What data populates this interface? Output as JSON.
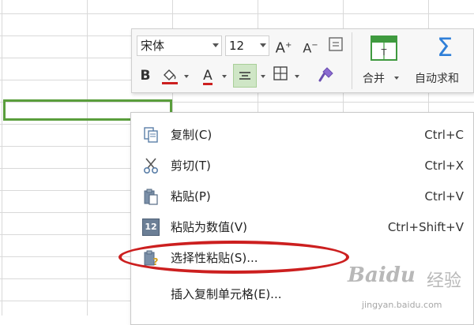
{
  "toolbar": {
    "font_name": "宋体",
    "font_size": "12",
    "grow_font_glyph": "A",
    "shrink_font_glyph": "A",
    "bold_glyph": "B",
    "font_color_glyph": "A",
    "merge_label": "合并",
    "autosum_label": "自动求和",
    "autosum_glyph": "Σ"
  },
  "context_menu": {
    "items": [
      {
        "label": "复制(C)",
        "shortcut": "Ctrl+C",
        "icon": "copy-icon"
      },
      {
        "label": "剪切(T)",
        "shortcut": "Ctrl+X",
        "icon": "scissors-icon"
      },
      {
        "label": "粘贴(P)",
        "shortcut": "Ctrl+V",
        "icon": "paste-icon"
      },
      {
        "label": "粘贴为数值(V)",
        "shortcut": "Ctrl+Shift+V",
        "icon": "paste-values-icon"
      },
      {
        "label": "选择性粘贴(S)...",
        "shortcut": "",
        "icon": "paste-special-icon"
      },
      {
        "label": "插入复制单元格(E)...",
        "shortcut": "",
        "icon": ""
      }
    ],
    "paste_values_badge": "12"
  },
  "watermark": {
    "brand": "Baidu",
    "cn": "经验",
    "url": "jingyan.baidu.com"
  },
  "colors": {
    "selection_border": "#5a9e3c",
    "highlight_ellipse": "#cc1f1f",
    "font_color_bar": "#cc1f1f",
    "fill_color_bar": "#cc1f1f",
    "autosum_blue": "#2f7fd8",
    "merge_green": "#3f9a3f"
  }
}
